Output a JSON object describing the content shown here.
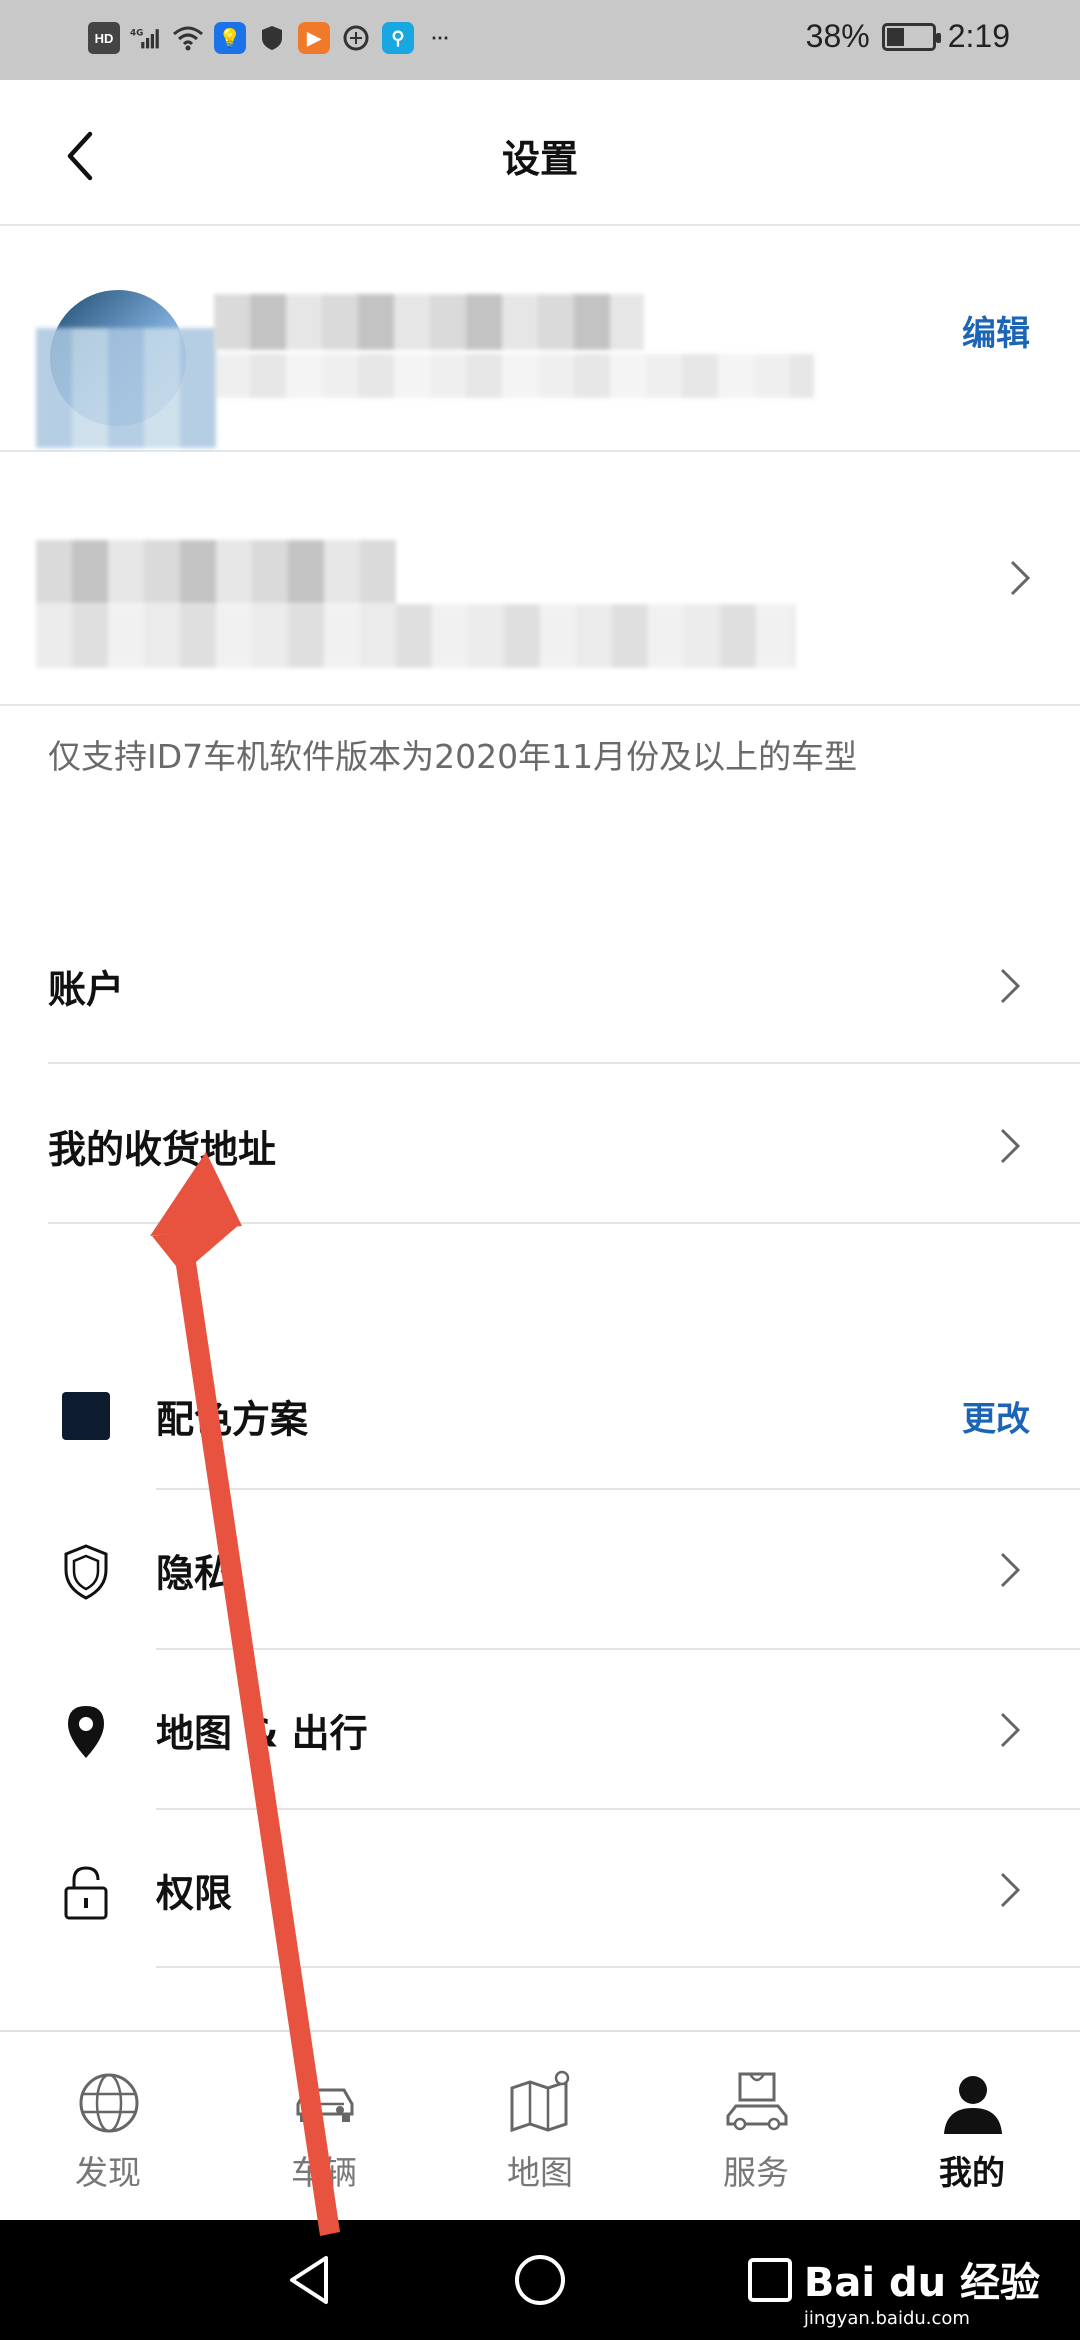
{
  "status_bar": {
    "left_icons": [
      "hd-icon",
      "4g-signal-icon",
      "wifi-icon",
      "lightbulb-app-icon",
      "shield-app-icon",
      "video-app-icon",
      "browser-app-icon",
      "search-app-icon",
      "more-dots-icon"
    ],
    "hd_label": "HD",
    "signal_label": "4G",
    "battery_percent": "38%",
    "battery_level": 0.38,
    "time": "2:19"
  },
  "header": {
    "title": "设置",
    "back_icon": "chevron-left-icon"
  },
  "profile": {
    "edit_label": "编辑"
  },
  "vehicle_note": "仅支持ID7车机软件版本为2020年11月份及以上的车型",
  "menu_group_1": [
    {
      "label": "账户"
    },
    {
      "label": "我的收货地址"
    }
  ],
  "menu_group_2": [
    {
      "label": "配色方案",
      "icon": "color-swatch-icon",
      "action": "更改"
    },
    {
      "label": "隐私",
      "icon": "shield-icon"
    },
    {
      "label": "地图 & 出行",
      "icon": "location-pin-icon"
    },
    {
      "label": "权限",
      "icon": "lock-icon"
    }
  ],
  "tab_bar": [
    {
      "label": "发现",
      "icon": "globe-icon",
      "active": false
    },
    {
      "label": "车辆",
      "icon": "car-icon",
      "active": false
    },
    {
      "label": "地图",
      "icon": "map-icon",
      "active": false
    },
    {
      "label": "服务",
      "icon": "shopping-car-icon",
      "active": false
    },
    {
      "label": "我的",
      "icon": "person-icon",
      "active": true
    }
  ],
  "colors": {
    "link_blue": "#1c64b6",
    "swatch": "#0c1c2e",
    "annotation_arrow": "#e8533f"
  },
  "watermark": {
    "brand": "Bai du 经验",
    "url": "jingyan.baidu.com"
  }
}
